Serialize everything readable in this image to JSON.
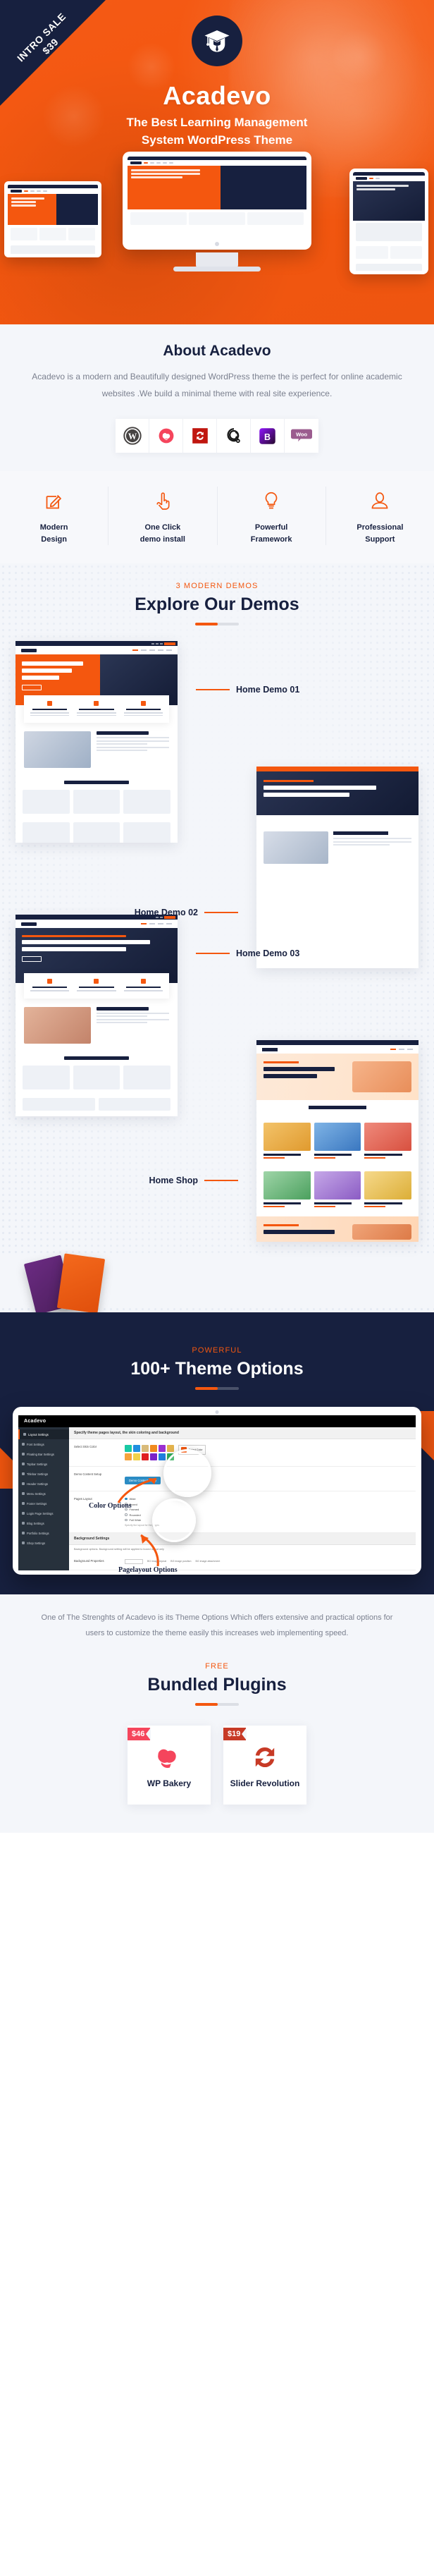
{
  "ribbon": {
    "line1": "INTRO SALE",
    "line2": "$39"
  },
  "hero": {
    "logo_icon": "graduation-cap-icon",
    "title": "Acadevo",
    "subtitle_line1": "The Best Learning Management",
    "subtitle_line2": "System WordPress Theme"
  },
  "about": {
    "heading": "About Acadevo",
    "paragraph": "Acadevo is a modern and Beautifully designed WordPress theme the is perfect for online academic websites .We build a minimal theme with real site experience.",
    "tech": [
      {
        "name": "wordpress-icon",
        "label": "WordPress"
      },
      {
        "name": "wpbakery-icon",
        "label": "WP Bakery"
      },
      {
        "name": "slider-revolution-icon",
        "label": "Slider Revolution"
      },
      {
        "name": "tutor-lms-icon",
        "label": "Tutor LMS"
      },
      {
        "name": "bootstrap-icon",
        "label": "Bootstrap"
      },
      {
        "name": "woocommerce-icon",
        "label": "WooCommerce"
      }
    ]
  },
  "features": [
    {
      "icon": "pencil-square-icon",
      "line1": "Modern",
      "line2": "Design"
    },
    {
      "icon": "pointing-hand-icon",
      "line1": "One Click",
      "line2": "demo install"
    },
    {
      "icon": "lightbulb-icon",
      "line1": "Powerful",
      "line2": "Framework"
    },
    {
      "icon": "user-icon",
      "line1": "Professional",
      "line2": "Support"
    }
  ],
  "demos": {
    "kicker": "3 MODERN DEMOS",
    "title": "Explore Our Demos",
    "items": [
      {
        "label": "Home Demo 01",
        "align": "right"
      },
      {
        "label": "Home Demo 02",
        "align": "left"
      },
      {
        "label": "Home Demo 03",
        "align": "right"
      },
      {
        "label": "Home Shop",
        "align": "left"
      }
    ]
  },
  "theme_options": {
    "kicker": "POWERFUL",
    "title": "100+ Theme Options",
    "admin": {
      "brand": "Acadevo",
      "panel_heading": "Specify theme pages layout, the skin coloring and background",
      "sidebar": [
        "Layout Settings",
        "Font Settings",
        "Floating Bar Settings",
        "Topbar Settings",
        "Titlebar Settings",
        "Header Settings",
        "Menu Settings",
        "Footer Settings",
        "Login Page Settings",
        "Blog Settings",
        "Portfolio Settings",
        "Shop Settings"
      ],
      "rows": [
        {
          "label": "Select Skin Color",
          "control": "swatches",
          "button": "Select Color"
        },
        {
          "label": "Demo Content Setup",
          "control": "button",
          "button": "Demo Content Setup"
        },
        {
          "label": "Pages Layout",
          "control": "radios",
          "options": [
            "Wide",
            "Boxed",
            "Framed",
            "Rounded",
            "Full Wide"
          ],
          "hint": "Specify the layout for the pages"
        }
      ],
      "bg_section_title": "Background Settings",
      "bg_section_hint": "Background options. Background setting will be applied to boxed layout only",
      "bg_row_label": "Background Properties",
      "bg_fields": [
        "BG image repeat",
        "BG image position",
        "BG image attachment"
      ]
    },
    "annotations": [
      {
        "text": "Color Options"
      },
      {
        "text": "Pagelayout  Options"
      }
    ],
    "description": "One of The Strenghts of Acadevo is its Theme Options Which offers extensive and practical options for users to customize the theme easily this increases web implementing speed."
  },
  "plugins": {
    "kicker": "FREE",
    "title": "Bundled Plugins",
    "items": [
      {
        "price": "$46",
        "name": "WP Bakery",
        "icon": "wpbakery-icon",
        "tag_style": "red"
      },
      {
        "price": "$19",
        "name": "Slider Revolution",
        "icon": "slider-revolution-icon",
        "tag_style": "dark"
      }
    ]
  },
  "colors": {
    "accent": "#f4570f",
    "dark": "#17203f",
    "light_bg": "#f4f6fa"
  }
}
